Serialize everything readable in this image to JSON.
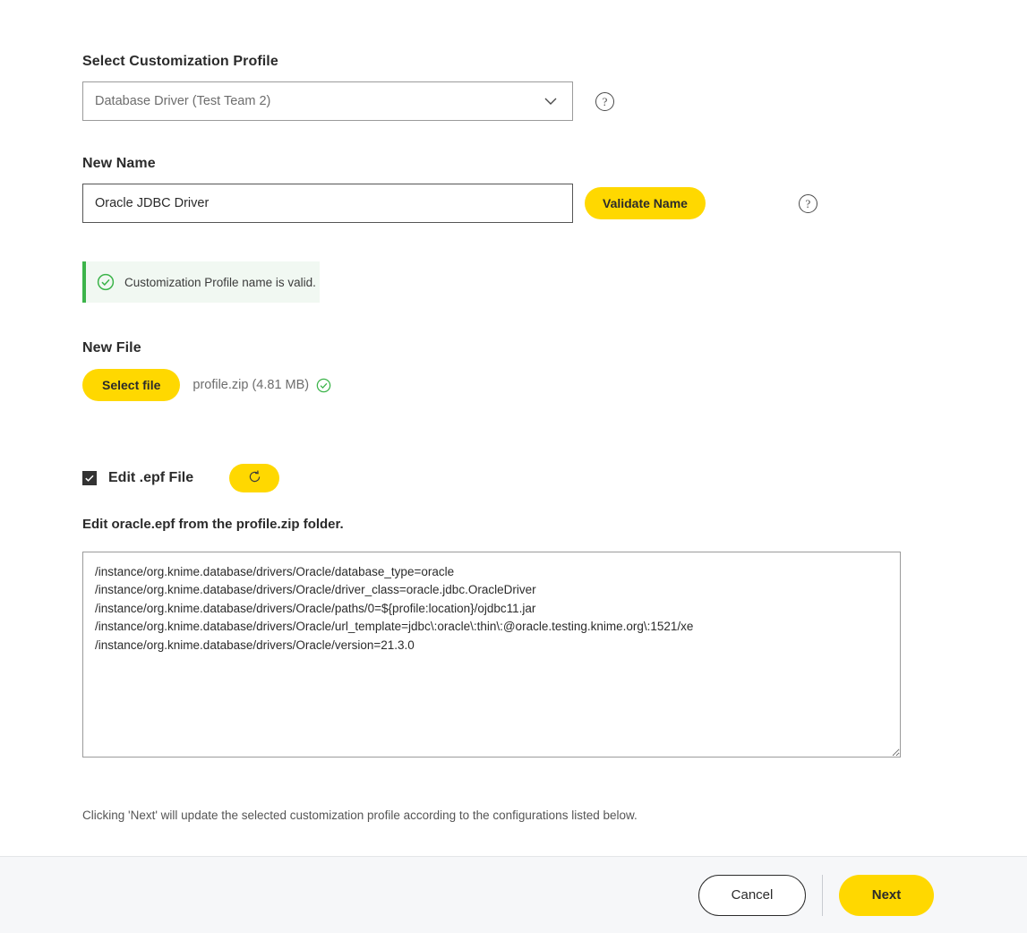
{
  "colors": {
    "accent_yellow": "#FFD800",
    "success_green": "#3cb44a",
    "success_bg": "#f1f8f2",
    "footer_bg": "#f6f7f9",
    "text": "#2b2b2b"
  },
  "profile_section": {
    "label": "Select Customization Profile",
    "selected_value": "Database Driver (Test Team 2)",
    "help_glyph": "?"
  },
  "name_section": {
    "label": "New Name",
    "value": "Oracle JDBC Driver",
    "placeholder": "",
    "validate_button": "Validate Name",
    "help_glyph": "?"
  },
  "validation": {
    "message": "Customization Profile name is valid."
  },
  "file_section": {
    "label": "New File",
    "select_file_button": "Select file",
    "file_name": "profile.zip (4.81 MB)"
  },
  "epf_section": {
    "checkbox_label": "Edit .epf File",
    "checkbox_checked": true,
    "subtitle": "Edit oracle.epf from the profile.zip folder.",
    "textarea_value": "/instance/org.knime.database/drivers/Oracle/database_type=oracle\n/instance/org.knime.database/drivers/Oracle/driver_class=oracle.jdbc.OracleDriver\n/instance/org.knime.database/drivers/Oracle/paths/0=${profile:location}/ojdbc11.jar\n/instance/org.knime.database/drivers/Oracle/url_template=jdbc\\:oracle\\:thin\\:@oracle.testing.knime.org\\:1521/xe\n/instance/org.knime.database/drivers/Oracle/version=21.3.0"
  },
  "footnote": "Clicking 'Next' will update the selected customization profile according to the configurations listed below.",
  "footer": {
    "cancel_label": "Cancel",
    "next_label": "Next"
  }
}
